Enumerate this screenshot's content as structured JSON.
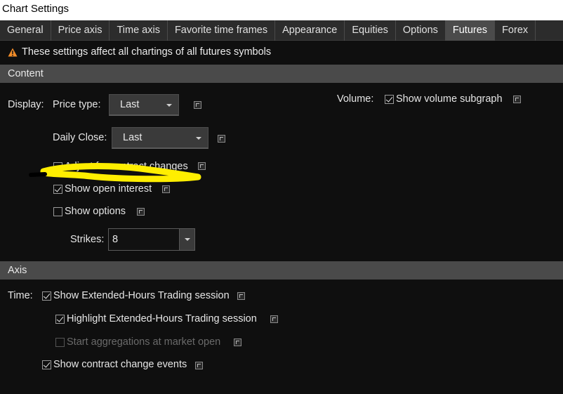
{
  "window": {
    "title": "Chart Settings"
  },
  "tabs": [
    {
      "label": "General"
    },
    {
      "label": "Price axis"
    },
    {
      "label": "Time axis"
    },
    {
      "label": "Favorite time frames"
    },
    {
      "label": "Appearance"
    },
    {
      "label": "Equities"
    },
    {
      "label": "Options"
    },
    {
      "label": "Futures"
    },
    {
      "label": "Forex"
    }
  ],
  "active_tab": "Futures",
  "notice": {
    "text": "These settings affect all chartings of all futures symbols",
    "icon": "warning-icon"
  },
  "content": {
    "header": "Content",
    "display_label": "Display:",
    "price_type": {
      "label": "Price type:",
      "value": "Last"
    },
    "daily_close": {
      "label": "Daily Close:",
      "value": "Last"
    },
    "adjust_contract": {
      "label": "Adjust for contract changes",
      "checked": false
    },
    "open_interest": {
      "label": "Show open interest",
      "checked": true
    },
    "show_options": {
      "label": "Show options",
      "checked": false
    },
    "strikes": {
      "label": "Strikes:",
      "value": "8"
    },
    "volume_label": "Volume:",
    "volume_subgraph": {
      "label": "Show volume subgraph",
      "checked": true
    }
  },
  "axis": {
    "header": "Axis",
    "time_label": "Time:",
    "ext_hours": {
      "label": "Show Extended-Hours Trading session",
      "checked": true
    },
    "highlight_ext": {
      "label": "Highlight Extended-Hours Trading session",
      "checked": true
    },
    "start_agg": {
      "label": "Start aggregations at market open",
      "checked": false,
      "disabled": true
    },
    "contract_events": {
      "label": "Show contract change events",
      "checked": true
    }
  },
  "colors": {
    "background": "#0f0f0f",
    "section_header": "#4a4a4a",
    "active_tab": "#4b4b4b",
    "warning": "#f28c28",
    "annotation": "#ffee00"
  }
}
